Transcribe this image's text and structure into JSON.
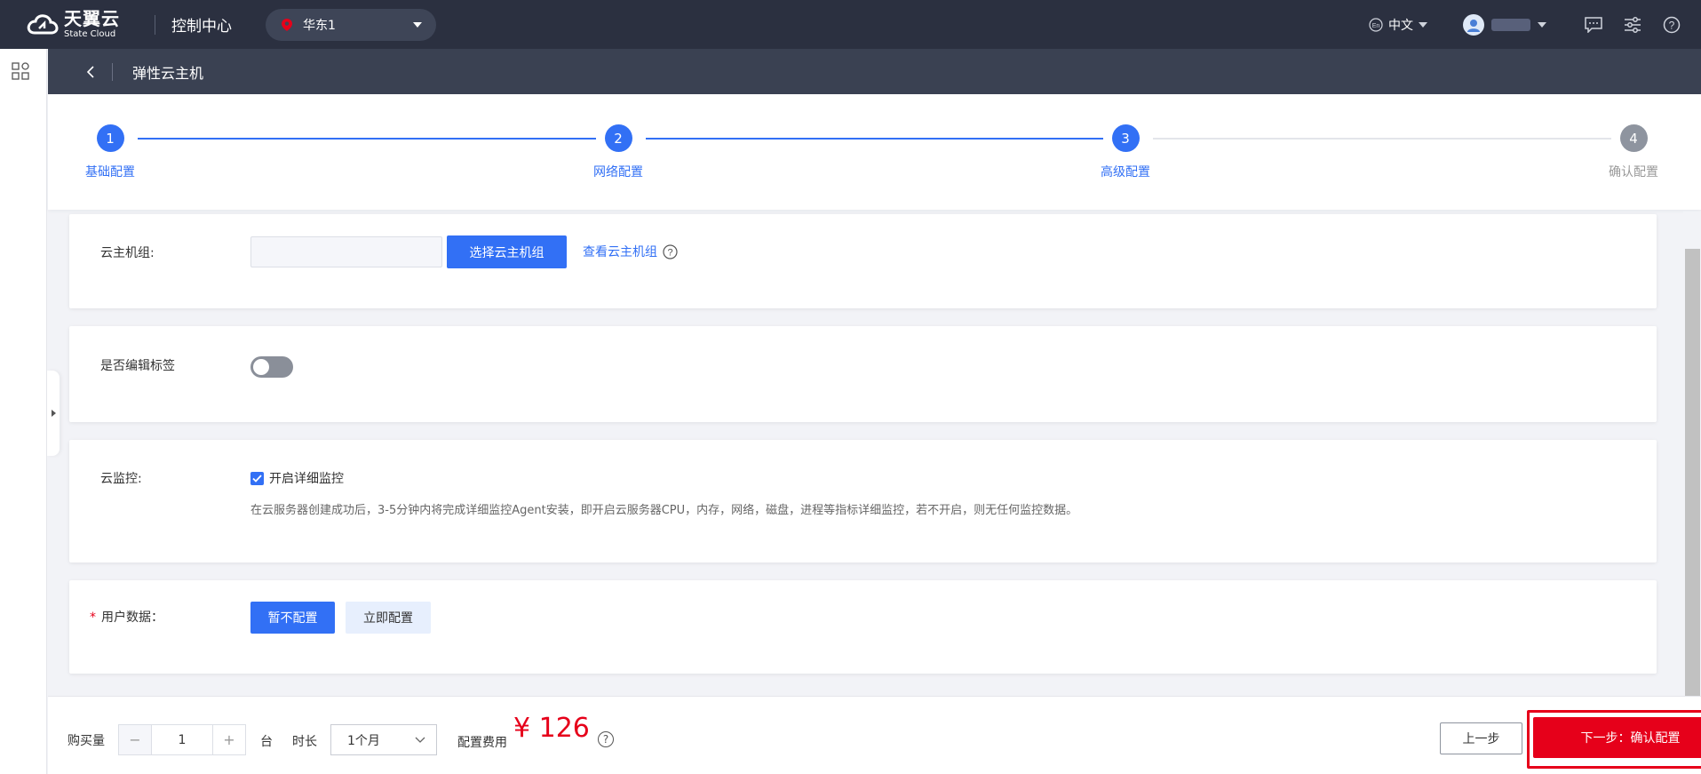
{
  "topbar": {
    "brand_title": "天翼云",
    "brand_sub": "State Cloud",
    "console_title": "控制中心",
    "region": "华东1",
    "language": "中文"
  },
  "subheader": {
    "title": "弹性云主机"
  },
  "steps": [
    {
      "number": "1",
      "label": "基础配置"
    },
    {
      "number": "2",
      "label": "网络配置"
    },
    {
      "number": "3",
      "label": "高级配置"
    },
    {
      "number": "4",
      "label": "确认配置"
    }
  ],
  "host_group": {
    "label": "云主机组:",
    "input_value": "",
    "select_button": "选择云主机组",
    "view_link": "查看云主机组"
  },
  "tags": {
    "label": "是否编辑标签"
  },
  "monitor": {
    "label": "云监控:",
    "checkbox_label": "开启详细监控",
    "description": "在云服务器创建成功后，3-5分钟内将完成详细监控Agent安装，即开启云服务器CPU，内存，网络，磁盘，进程等指标详细监控，若不开启，则无任何监控数据。"
  },
  "user_data": {
    "required_mark": "*",
    "label": "用户数据：",
    "option_none": "暂不配置",
    "option_now": "立即配置"
  },
  "bottom": {
    "quantity_label": "购买量",
    "quantity_minus": "−",
    "quantity_value": "1",
    "quantity_plus": "+",
    "quantity_unit": "台",
    "duration_label": "时长",
    "duration_value": "1个月",
    "fee_label": "配置费用",
    "price": "¥ 126",
    "help": "?",
    "prev_button": "上一步",
    "next_button": "下一步：确认配置"
  },
  "colors": {
    "primary": "#3270f5",
    "danger": "#e6001a",
    "topbar": "#2b3040"
  }
}
